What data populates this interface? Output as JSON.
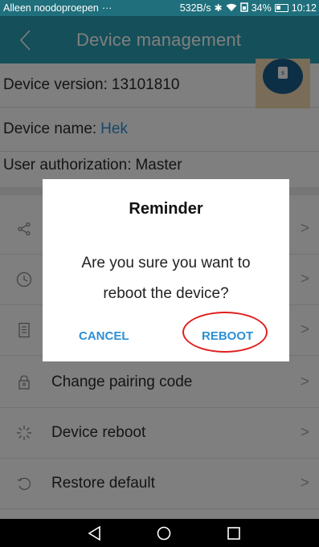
{
  "status_bar": {
    "carrier": "Alleen noodoproepen",
    "dots": "···",
    "speed": "532B/s",
    "battery": "34%",
    "time": "10:12"
  },
  "header": {
    "title": "Device management"
  },
  "info": {
    "version_label": "Device version:",
    "version_value": "13101810",
    "name_label": "Device name:",
    "name_value": "Hek",
    "auth_label": "User authorization:",
    "auth_value": "Master"
  },
  "menu": {
    "items": [
      {
        "icon": "share-icon",
        "label": ""
      },
      {
        "icon": "clock-icon",
        "label": ""
      },
      {
        "icon": "document-icon",
        "label": ""
      },
      {
        "icon": "lock-icon",
        "label": "Change pairing code"
      },
      {
        "icon": "reboot-icon",
        "label": "Device reboot"
      },
      {
        "icon": "restore-icon",
        "label": "Restore default"
      }
    ]
  },
  "dialog": {
    "title": "Reminder",
    "message": "Are you sure you want to reboot the device?",
    "cancel_label": "CANCEL",
    "confirm_label": "REBOOT"
  },
  "colors": {
    "status_bar": "#1f6f7c",
    "header": "#2b9fb2",
    "link": "#2d8fd5",
    "highlight": "#e02020"
  }
}
